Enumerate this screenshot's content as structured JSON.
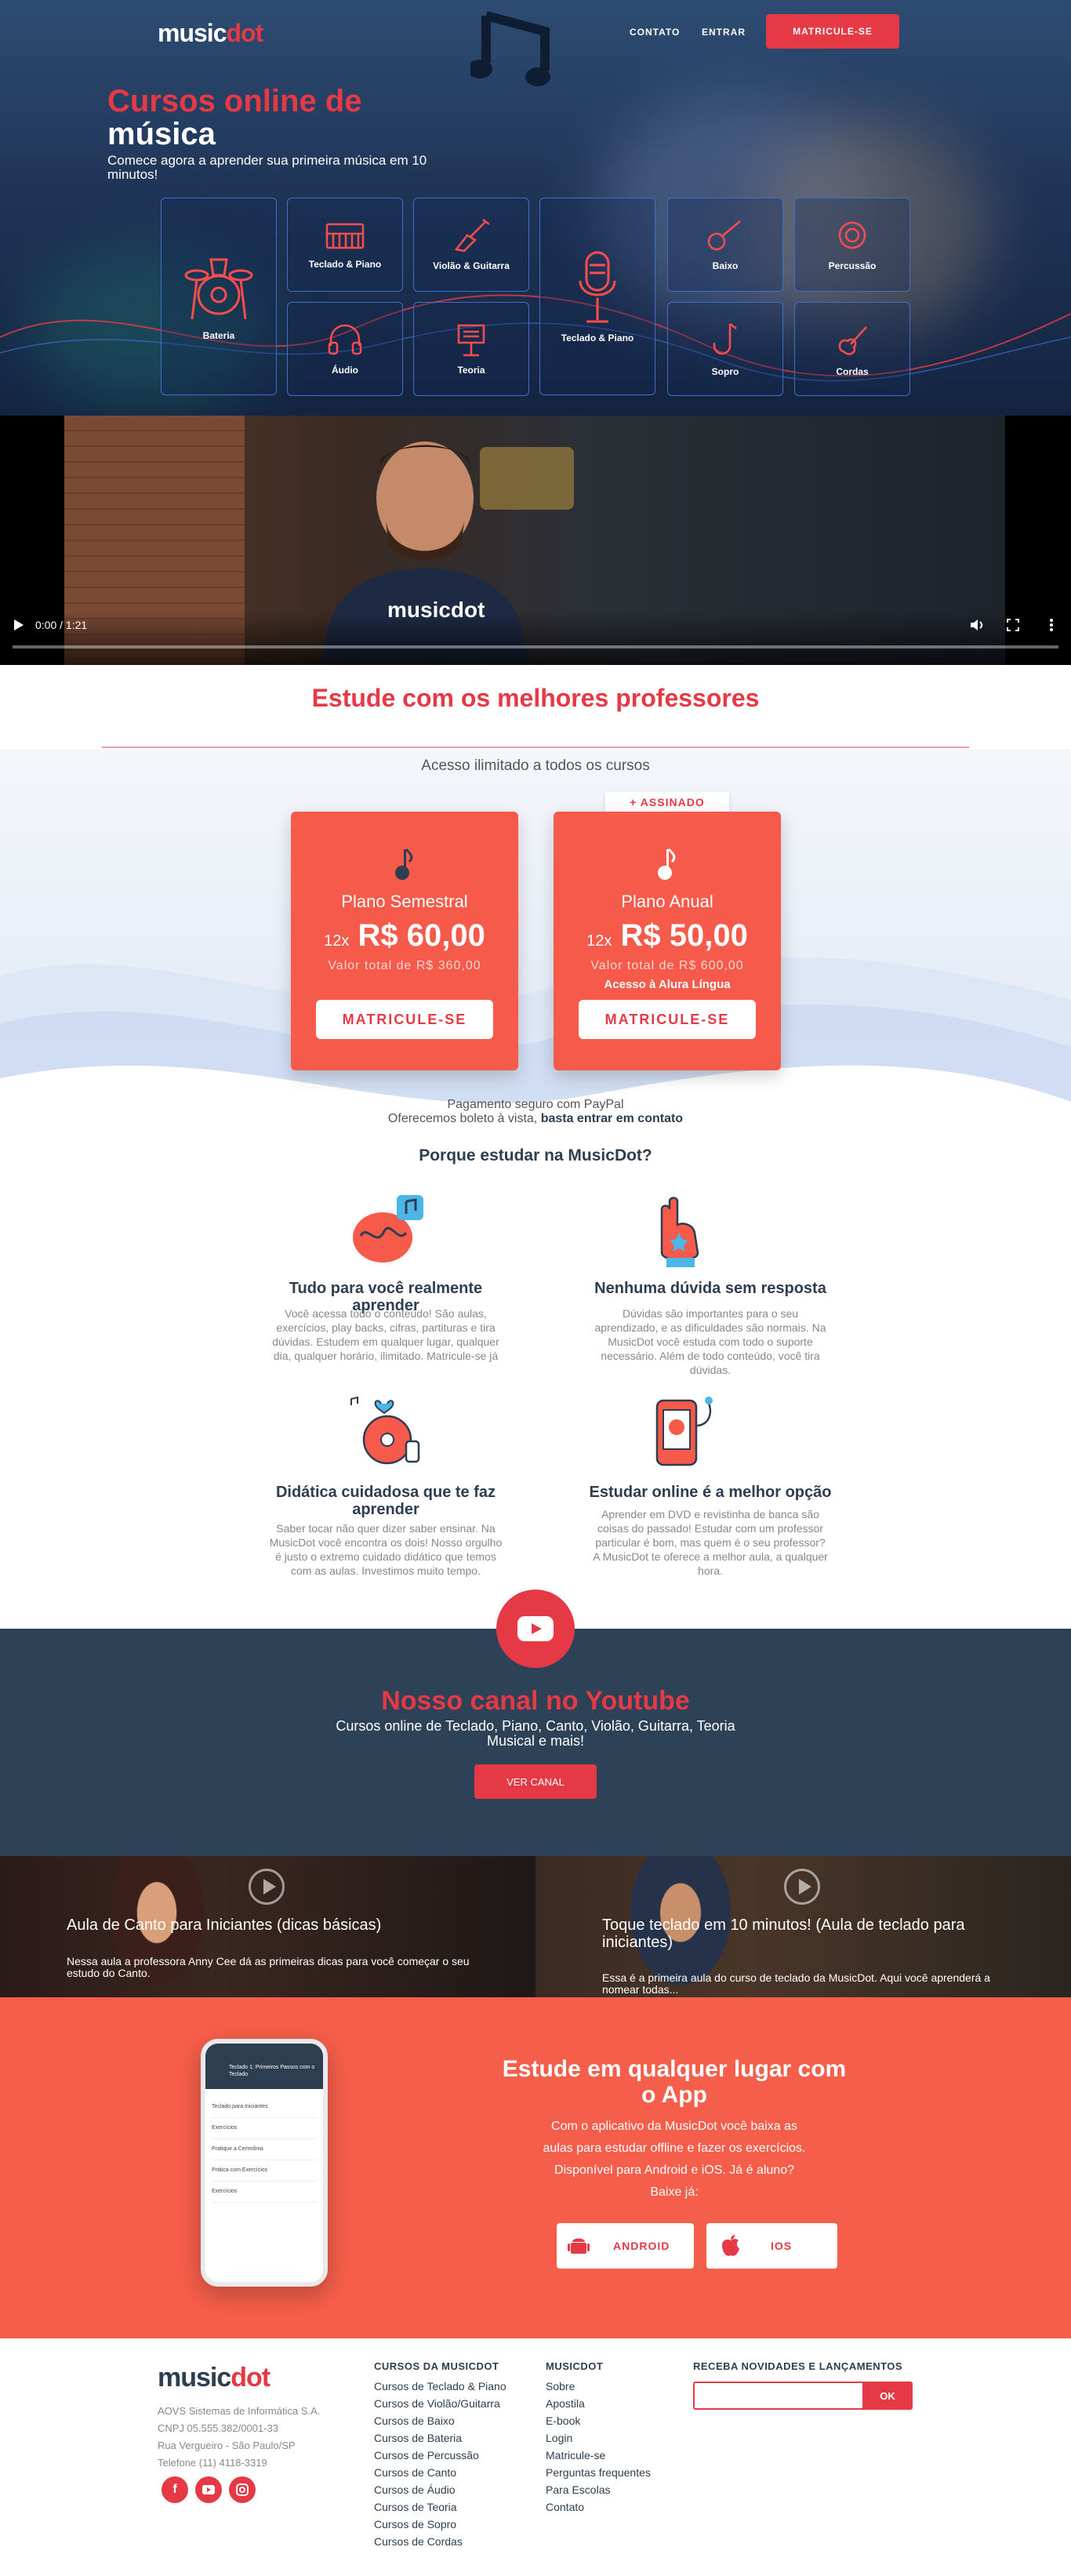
{
  "brand": {
    "name_main": "music",
    "name_accent": "dot",
    "accent_color": "#e63946",
    "dark_color": "#2d3e50",
    "coral_color": "#f55a4a"
  },
  "nav": {
    "contato": "CONTATO",
    "entrar": "ENTRAR",
    "cta": "MATRICULE-SE"
  },
  "hero": {
    "title_line1": "Cursos online de",
    "title_line2": "música",
    "subtitle": "Comece agora a aprender sua primeira música em 10 minutos!",
    "tiles": [
      {
        "label": "Bateria",
        "icon": "drum-kit-icon"
      },
      {
        "label": "Teclado & Piano",
        "icon": "keyboard-icon"
      },
      {
        "label": "Violão & Guitarra",
        "icon": "guitar-icon"
      },
      {
        "label": "Teclado & Piano",
        "icon": "microphone-icon"
      },
      {
        "label": "Baixo",
        "icon": "bass-icon"
      },
      {
        "label": "Percussão",
        "icon": "percussion-icon"
      },
      {
        "label": "Áudio",
        "icon": "headphones-icon"
      },
      {
        "label": "Teoria",
        "icon": "music-stand-icon"
      },
      {
        "label": "Sopro",
        "icon": "saxophone-icon"
      },
      {
        "label": "Cordas",
        "icon": "violin-icon"
      }
    ]
  },
  "video": {
    "time": "0:00 / 1:21",
    "shirt_text": "musicdot"
  },
  "professors": {
    "title": "Estude com os melhores professores"
  },
  "plans": {
    "access": "Acesso ilimitado a todos os cursos",
    "badge": "+ ASSINADO",
    "items": [
      {
        "name": "Plano Semestral",
        "installments": "12x",
        "price": "R$ 60,00",
        "total": "Valor total de R$ 360,00",
        "extra": "",
        "button": "MATRICULE-SE"
      },
      {
        "name": "Plano Anual",
        "installments": "12x",
        "price": "R$ 50,00",
        "total": "Valor total de R$ 600,00",
        "extra": "Acesso à Alura Língua",
        "button": "MATRICULE-SE"
      }
    ],
    "pay_line1": "Pagamento seguro com PayPal",
    "pay_line2": "Oferecemos boleto à vista,",
    "pay_link": "basta entrar em contato"
  },
  "why": {
    "title": "Porque estudar na MusicDot?",
    "features": [
      {
        "title": "Tudo para você realmente aprender",
        "text": "Você acessa todo o conteúdo! São aulas, exercícios, play backs, cifras, partituras e tira dúvidas. Estudem em qualquer lugar, qualquer dia, qualquer horário, ilimitado. Matricule-se já"
      },
      {
        "title": "Nenhuma dúvida sem resposta",
        "text": "Dúvidas são importantes para o seu aprendizado, e as dificuldades são normais. Na MusicDot você estuda com todo o suporte necessário. Além de todo conteúdo, você tira dúvidas."
      },
      {
        "title": "Didática cuidadosa que te faz aprender",
        "text": "Saber tocar não quer dizer saber ensinar. Na MusicDot você encontra os dois! Nosso orgulho é justo o extremo cuidado didático que temos com as aulas. Investimos muito tempo."
      },
      {
        "title": "Estudar online é a melhor opção",
        "text": "Aprender em DVD e revistinha de banca são coisas do passado! Estudar com um professor particular é bom, mas quem é o seu professor? A MusicDot te oferece a melhor aula, a qualquer hora."
      }
    ]
  },
  "youtube": {
    "title": "Nosso canal no Youtube",
    "subtitle": "Cursos online de Teclado, Piano, Canto, Violão, Guitarra, Teoria Musical e mais!",
    "button": "VER CANAL",
    "videos": [
      {
        "title": "Aula de Canto para Iniciantes (dicas básicas)",
        "desc": "Nessa aula a professora Anny Cee dá as primeiras dicas para você começar o seu estudo do Canto."
      },
      {
        "title": "Toque teclado em 10 minutos! (Aula de teclado para iniciantes)",
        "desc": "Essa é a primeira aula do curso de teclado da MusicDot. Aqui você aprenderá a nomear todas..."
      }
    ]
  },
  "app": {
    "title": "Estude em qualquer lugar com o App",
    "text": "Com o aplicativo da MusicDot você baixa as aulas para estudar offline e fazer os exercícios. Disponível para Android e iOS. Já é aluno? Baixe já:",
    "android": "ANDROID",
    "ios": "IOS",
    "phone_title": "Teclado 1: Primeiros Passos com o Teclado",
    "phone_items": [
      "Teclado para Iniciantes",
      "Exercícios",
      "Pratique a Cerimônia",
      "Prática com Exercícios",
      "Exercícios"
    ]
  },
  "footer": {
    "company": "AOVS Sistemas de Informática S.A.",
    "cnpj": "CNPJ 05.555.382/0001-33",
    "address": "Rua Vergueiro - São Paulo/SP",
    "phone": "Telefone (11) 4118-3319",
    "col1_title": "CURSOS DA MUSICDOT",
    "col1": [
      "Cursos de Teclado & Piano",
      "Cursos de Violão/Guitarra",
      "Cursos de Baixo",
      "Cursos de Bateria",
      "Cursos de Percussão",
      "Cursos de Canto",
      "Cursos de Áudio",
      "Cursos de Teoria",
      "Cursos de Sopro",
      "Cursos de Cordas"
    ],
    "col2_title": "MUSICDOT",
    "col2": [
      "Sobre",
      "Apostila",
      "E-book",
      "Login",
      "Matricule-se",
      "Perguntas frequentes",
      "Para Escolas",
      "Contato"
    ],
    "news_title": "RECEBA NOVIDADES E LANÇAMENTOS",
    "news_btn": "OK"
  }
}
